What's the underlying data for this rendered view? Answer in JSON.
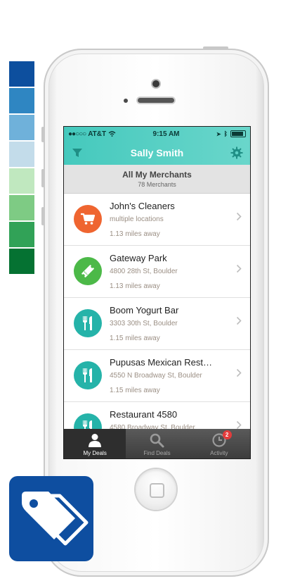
{
  "palette": [
    "#0d4f9e",
    "#2f86c2",
    "#6fb1da",
    "#c3dcea",
    "#c0e8bf",
    "#7ecb84",
    "#31a257",
    "#057232"
  ],
  "status_bar": {
    "carrier": "AT&T",
    "time": "9:15 AM"
  },
  "navbar": {
    "title": "Sally Smith",
    "accent": "#4ecdc0"
  },
  "section": {
    "title": "All My Merchants",
    "subtitle": "78 Merchants"
  },
  "merchants": [
    {
      "name": "John's Cleaners",
      "address": "multiple locations",
      "distance": "1.13 miles away",
      "icon": "cart-icon",
      "color": "#ef6530"
    },
    {
      "name": "Gateway Park",
      "address": "4800 28th St, Boulder",
      "distance": "1.13 miles away",
      "icon": "ticket-icon",
      "color": "#4cb948"
    },
    {
      "name": "Boom Yogurt Bar",
      "address": "3303 30th St, Boulder",
      "distance": "1.15 miles away",
      "icon": "fork-knife-icon",
      "color": "#25b3a9"
    },
    {
      "name": "Pupusas Mexican Rest…",
      "address": "4550 N Broadway St, Boulder",
      "distance": "1.15 miles away",
      "icon": "fork-knife-icon",
      "color": "#25b3a9"
    },
    {
      "name": "Restaurant 4580",
      "address": "4580 Broadway St, Boulder",
      "distance": "",
      "icon": "fork-knife-icon",
      "color": "#25b3a9"
    }
  ],
  "tabs": [
    {
      "label": "My Deals",
      "icon": "person-icon",
      "active": true
    },
    {
      "label": "Find Deals",
      "icon": "search-icon",
      "active": false
    },
    {
      "label": "Activity",
      "icon": "clock-icon",
      "active": false,
      "badge": "2"
    }
  ]
}
